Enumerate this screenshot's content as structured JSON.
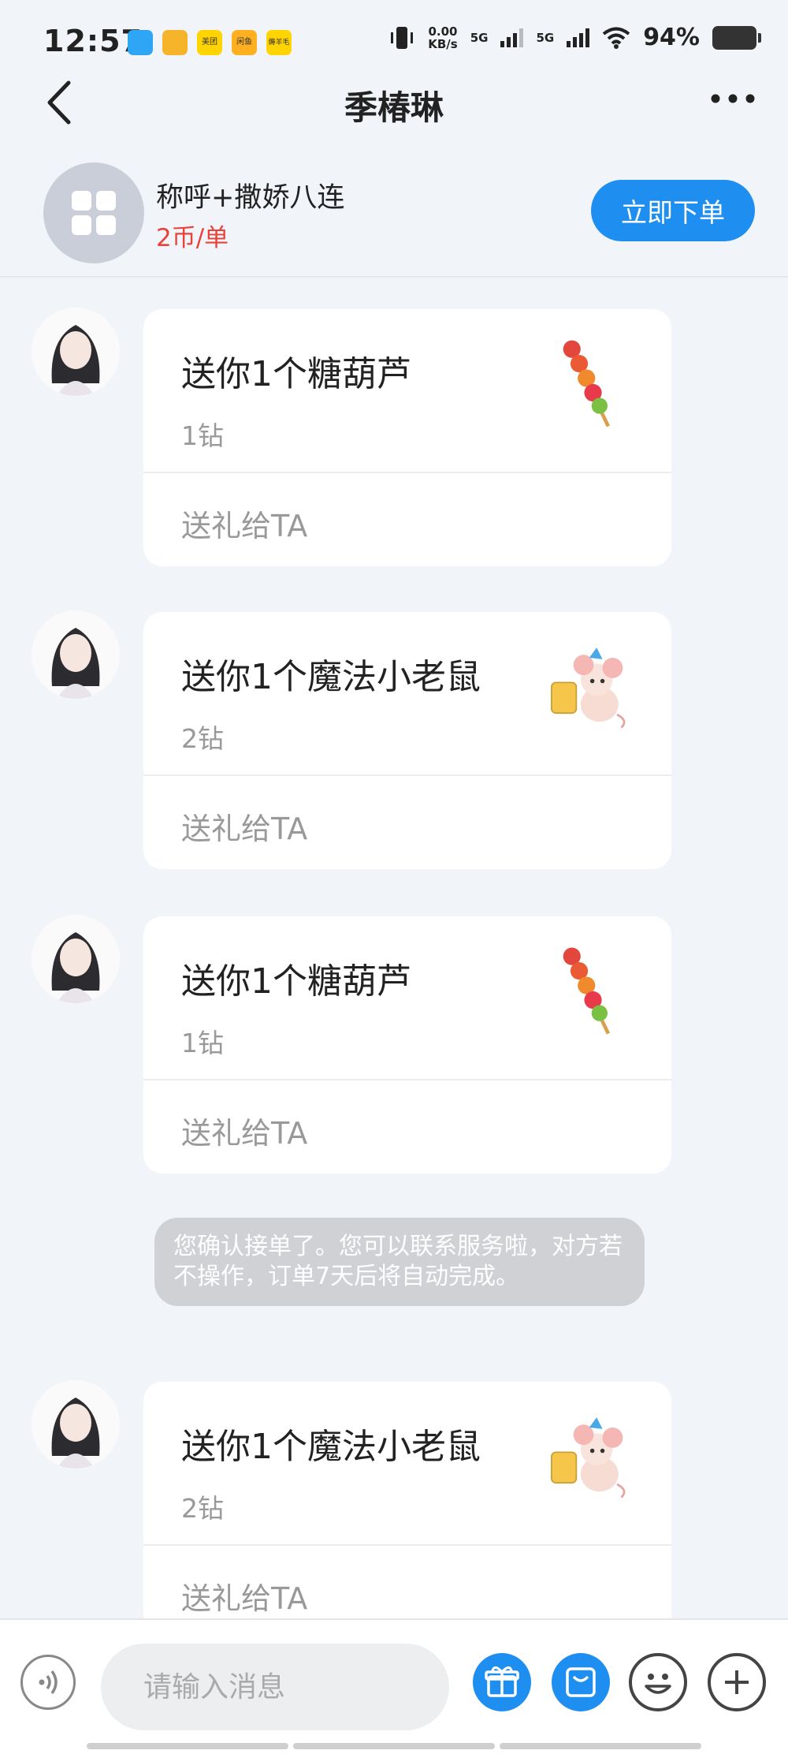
{
  "status_bar": {
    "time": "12:57",
    "app_badges": [
      "美团",
      "闲鱼",
      "薅羊毛"
    ],
    "net_speed_value": "0.00",
    "net_speed_unit": "KB/s",
    "gen1": "5G",
    "gen2": "5G",
    "battery": "94%"
  },
  "nav": {
    "title": "季椿琳"
  },
  "service": {
    "name": "称呼+撒娇八连",
    "price": "2币/单",
    "order_label": "立即下单"
  },
  "messages": [
    {
      "type": "gift",
      "title": "送你1个糖葫芦",
      "cost": "1钻",
      "action": "送礼给TA",
      "gift_icon": "tanghulu-icon"
    },
    {
      "type": "gift",
      "title": "送你1个魔法小老鼠",
      "cost": "2钻",
      "action": "送礼给TA",
      "gift_icon": "magic-mouse-icon"
    },
    {
      "type": "gift",
      "title": "送你1个糖葫芦",
      "cost": "1钻",
      "action": "送礼给TA",
      "gift_icon": "tanghulu-icon"
    },
    {
      "type": "system",
      "text": "您确认接单了。您可以联系服务啦，对方若不操作，订单7天后将自动完成。"
    },
    {
      "type": "gift",
      "title": "送你1个魔法小老鼠",
      "cost": "2钻",
      "action": "送礼给TA",
      "gift_icon": "magic-mouse-icon"
    }
  ],
  "input_bar": {
    "placeholder": "请输入消息"
  },
  "colors": {
    "accent": "#1f8ef1",
    "price": "#e8433a",
    "background": "#f1f4f8"
  }
}
